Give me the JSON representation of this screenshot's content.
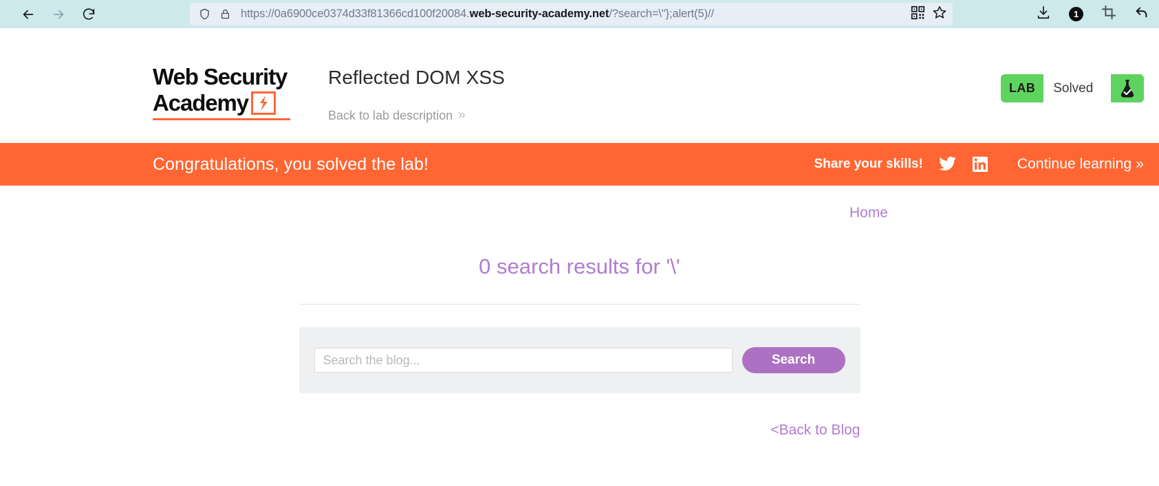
{
  "browser": {
    "back_icon": "back-arrow-icon",
    "forward_icon": "forward-arrow-icon",
    "reload_icon": "reload-icon",
    "shield_icon": "shield-icon",
    "lock_icon": "lock-icon",
    "url_prefix": "https://0a6900ce0374d33f81366cd100f20084.",
    "url_host": "web-security-academy.net",
    "url_suffix": "/?search=\\\"};alert(5)//",
    "qr_icon": "qr-code-icon",
    "bookmark_icon": "star-icon",
    "download_icon": "download-icon",
    "notification_count": "1",
    "crop_icon": "crop-icon",
    "undo_icon": "undo-arrow-icon"
  },
  "header": {
    "logo_line1": "Web Security",
    "logo_line2": "Academy",
    "bolt_icon": "lightning-bolt-icon",
    "lab_title": "Reflected DOM XSS",
    "back_to_description": "Back to lab description",
    "back_chevron": "double-chevron-right-icon",
    "lab_tag": "LAB",
    "lab_state": "Solved",
    "flask_icon": "flask-check-icon",
    "accent_green": "#5fd35f"
  },
  "banner": {
    "message": "Congratulations, you solved the lab!",
    "share_label": "Share your skills!",
    "twitter_icon": "twitter-icon",
    "linkedin_icon": "linkedin-icon",
    "continue_label": "Continue learning",
    "continue_chevron": "double-chevron-right-icon",
    "background": "#ff6633"
  },
  "main": {
    "home_link": "Home",
    "results_heading": "0 search results for '\\'",
    "search_placeholder": "Search the blog...",
    "search_value": "",
    "search_button": "Search",
    "back_to_blog": "<Back to Blog",
    "link_color": "#b07cd0"
  }
}
